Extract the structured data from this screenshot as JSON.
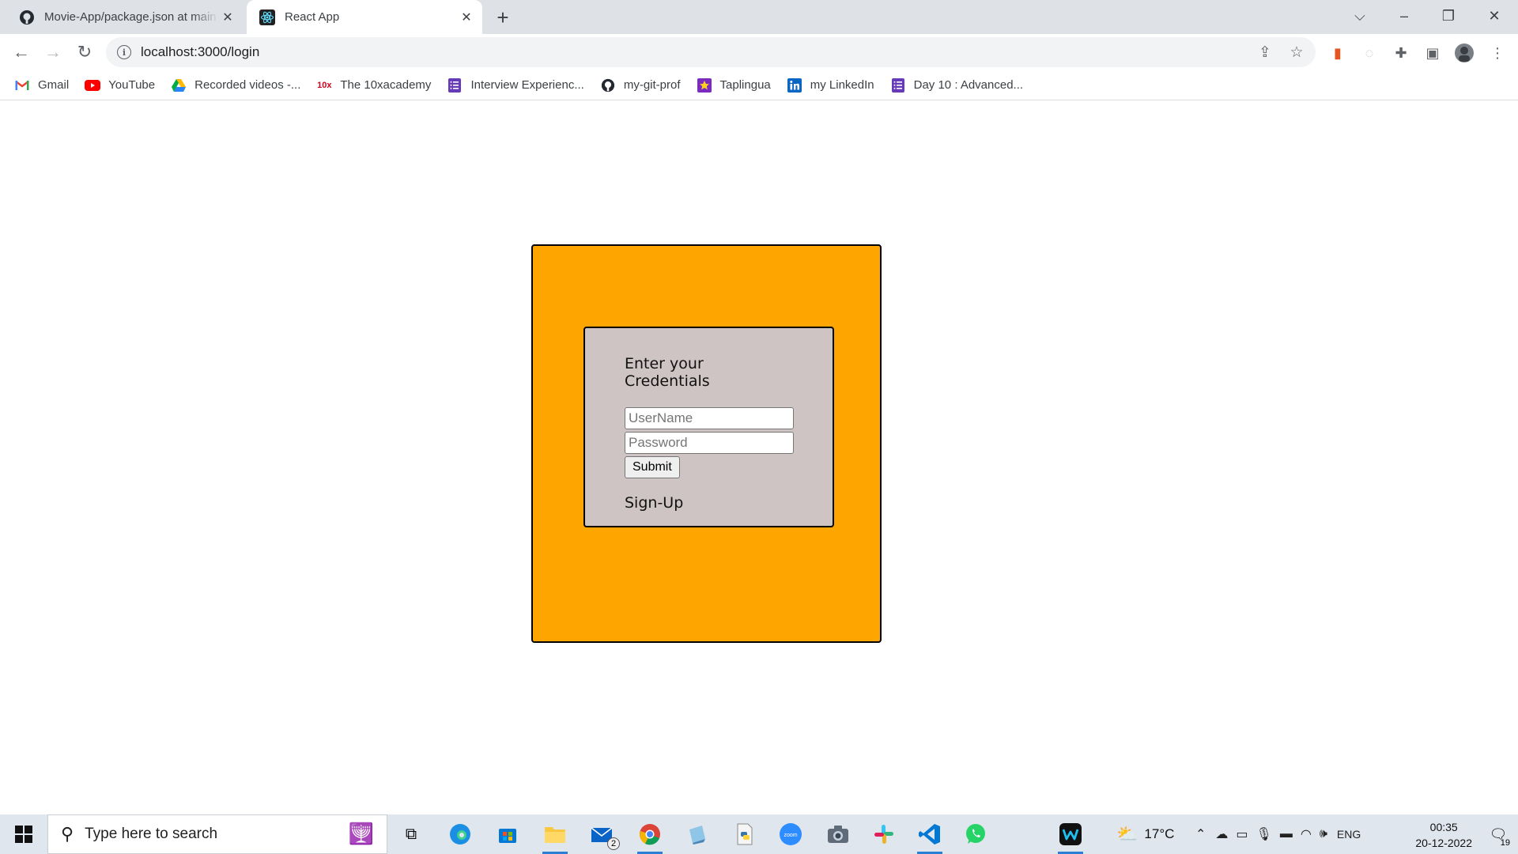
{
  "browser": {
    "tabs": [
      {
        "title": "Movie-App/package.json at main",
        "icon": "github-icon",
        "active": false
      },
      {
        "title": "React App",
        "icon": "react-icon",
        "active": true
      }
    ],
    "url": "localhost:3000/login",
    "bookmarks": [
      {
        "label": "Gmail",
        "icon": "gmail-icon"
      },
      {
        "label": "YouTube",
        "icon": "youtube-icon"
      },
      {
        "label": "Recorded videos -...",
        "icon": "google-drive-icon"
      },
      {
        "label": "The 10xacademy",
        "icon": "10x-icon"
      },
      {
        "label": "Interview Experienc...",
        "icon": "forms-icon"
      },
      {
        "label": "my-git-prof",
        "icon": "github-icon"
      },
      {
        "label": "Taplingua",
        "icon": "star-icon"
      },
      {
        "label": "my LinkedIn",
        "icon": "linkedin-icon"
      },
      {
        "label": "Day 10 : Advanced...",
        "icon": "forms-icon"
      }
    ]
  },
  "login": {
    "heading": "Enter your Credentials",
    "username_placeholder": "UserName",
    "password_placeholder": "Password",
    "submit_label": "Submit",
    "signup_label": "Sign-Up"
  },
  "colors": {
    "outer_box": "#ffa500",
    "card": "#cfc4c4"
  },
  "taskbar": {
    "search_placeholder": "Type here to search",
    "mail_badge": "2",
    "weather": "17°C",
    "language": "ENG",
    "time": "00:35",
    "date": "20-12-2022",
    "notification_count": "19"
  }
}
